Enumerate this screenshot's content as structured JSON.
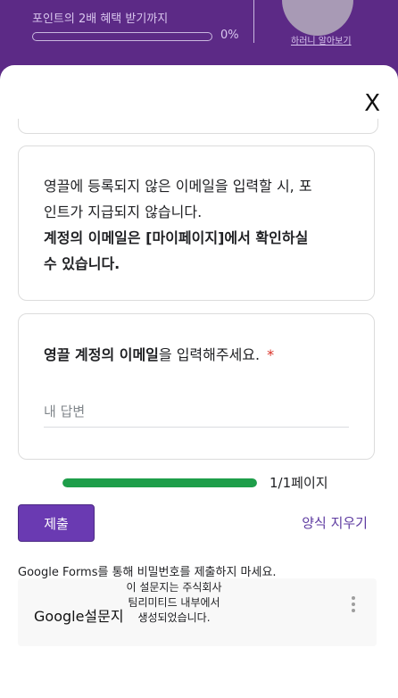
{
  "background": {
    "promo_text": "포인트의 2배 혜택 받기까지",
    "progress_percent": "0%",
    "progress_value": 0,
    "link_text": "하러니 알아보기"
  },
  "dialog": {
    "close_label": "X"
  },
  "info_card": {
    "line1": "영끌에 등록되지 않은 이메일을 입력할 시, 포",
    "line2": "인트가 지급되지 않습니다.",
    "line3": "계정의 이메일은 [마이페이지]에서 확인하실",
    "line4": "수 있습니다."
  },
  "question": {
    "title_bold": "영끌 계정의 이메일",
    "title_rest": "을 입력해주세요.",
    "required_mark": "*",
    "placeholder": "내 답변",
    "value": ""
  },
  "page_progress": {
    "fraction": 1.0,
    "label": "1/1페이지"
  },
  "actions": {
    "submit_label": "제출",
    "clear_label": "양식 지우기"
  },
  "notice": "Google Forms를 통해 비밀번호를 제출하지 마세요.",
  "footer": {
    "brand": "Google설문지",
    "description": "이 설문지는 주식회사 팀리미티드 내부에서 생성되었습니다."
  },
  "colors": {
    "header_purple": "#5c2a86",
    "submit_purple": "#6a3ab2",
    "progress_green": "#1e9e4a",
    "required_red": "#d93025"
  }
}
